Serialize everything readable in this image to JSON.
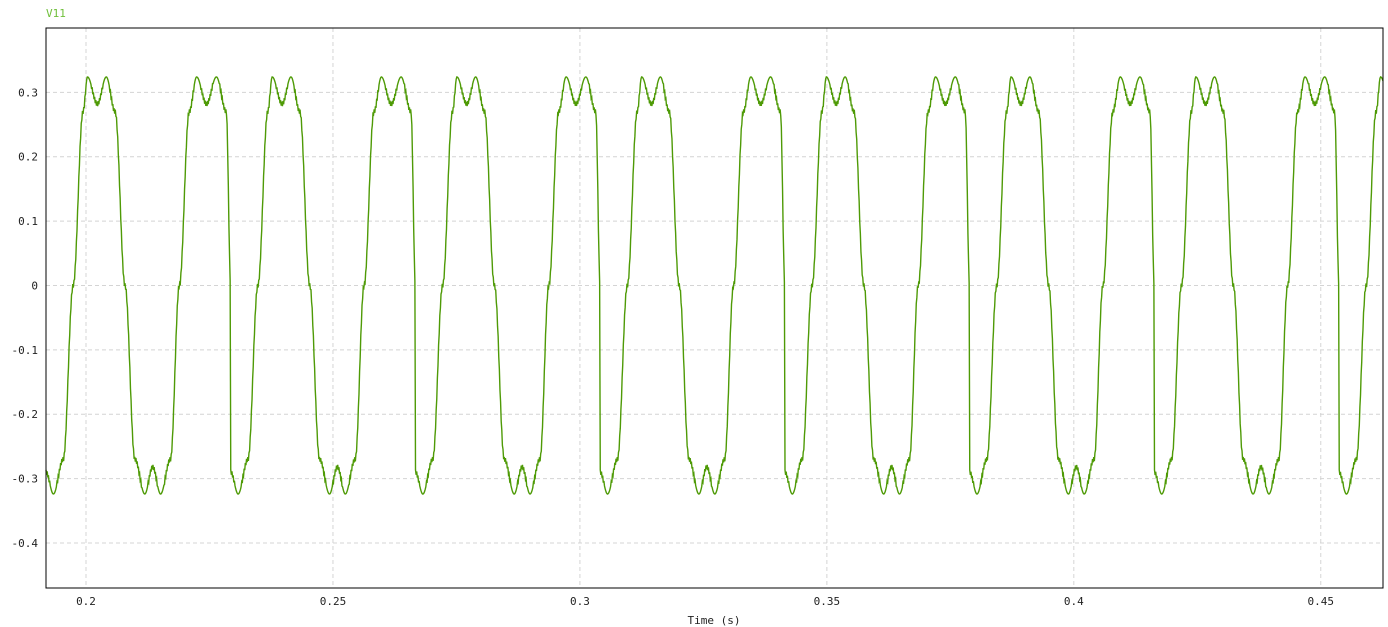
{
  "chart_data": {
    "type": "line",
    "title": "",
    "xlabel": "Time (s)",
    "ylabel": "",
    "xlim": [
      0.1919,
      0.4626
    ],
    "ylim": [
      -0.47,
      0.4
    ],
    "xticks": [
      0.2,
      0.25,
      0.3,
      0.35,
      0.4,
      0.45
    ],
    "xtick_labels": [
      "0.2",
      "0.25",
      "0.3",
      "0.35",
      "0.4",
      "0.45"
    ],
    "yticks": [
      0.3,
      0.2,
      0.1,
      0,
      -0.1,
      -0.2,
      -0.3,
      -0.4
    ],
    "ytick_labels": [
      "0.3",
      "0.2",
      "0.1",
      "0",
      "-0.1",
      "-0.2",
      "-0.3",
      "-0.4"
    ],
    "grid": true,
    "series": [
      {
        "name": "V11",
        "color": "#4e9a06",
        "waveform": "periodic, flat-topped with a central notch at each crest and trough",
        "period": 0.023,
        "peak": 0.324,
        "trough": -0.324,
        "notch_top": 0.282,
        "notch_bottom": -0.282,
        "x": [
          0.1919,
          0.1934,
          0.1954,
          0.1974,
          0.1994,
          0.2003,
          0.2023,
          0.2041,
          0.2059,
          0.2079,
          0.2099,
          0.2119,
          0.2135,
          0.2151,
          0.2171,
          0.2189,
          0.2209,
          0.2224,
          0.2244,
          0.2264,
          0.2284,
          0.2293
        ],
        "y": [
          -0.29,
          -0.324,
          -0.27,
          0.0,
          0.27,
          0.324,
          0.282,
          0.324,
          0.27,
          0.0,
          -0.27,
          -0.324,
          -0.282,
          -0.324,
          -0.27,
          0.0,
          0.27,
          0.324,
          0.282,
          0.324,
          0.27,
          0.0
        ]
      }
    ]
  }
}
